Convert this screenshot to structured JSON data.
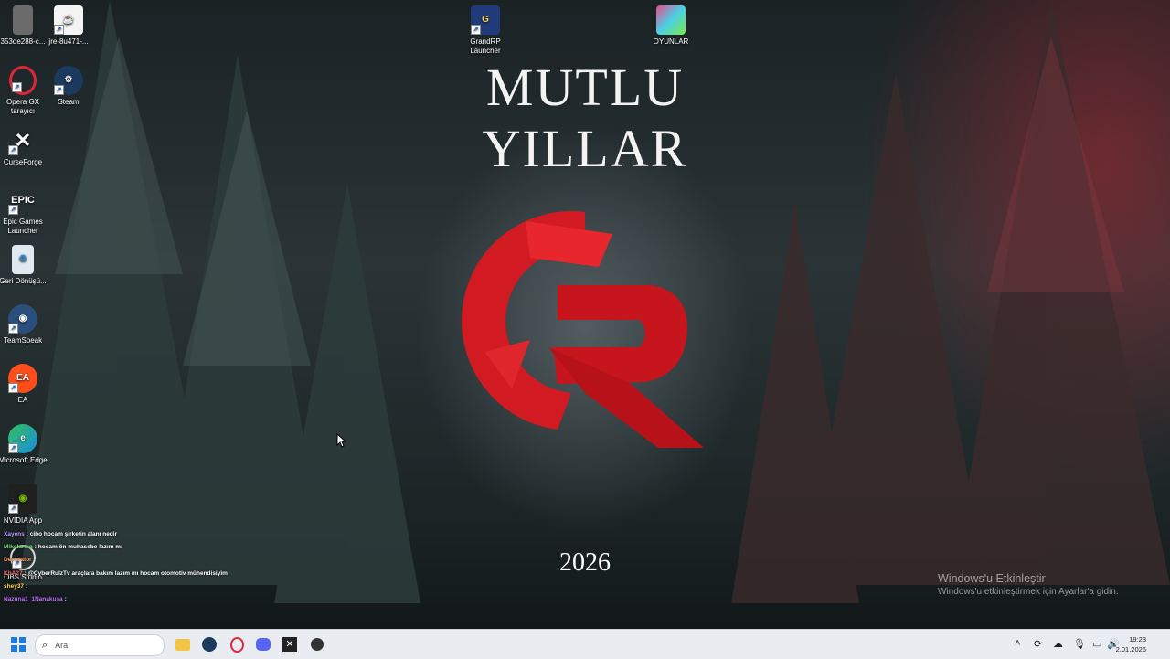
{
  "wallpaper": {
    "title": "MUTLU YILLAR",
    "year": "2026"
  },
  "desktop_icons": [
    {
      "label": "353de288-c...",
      "icon": "file-thumbnail-icon"
    },
    {
      "label": "jre-8u471-...",
      "icon": "java-icon"
    },
    {
      "label": "Opera GX tarayıcı",
      "icon": "opera-gx-icon"
    },
    {
      "label": "Steam",
      "icon": "steam-icon"
    },
    {
      "label": "CurseForge",
      "icon": "curseforge-icon"
    },
    {
      "label": "Epic Games Launcher",
      "icon": "epic-games-icon"
    },
    {
      "label": "Geri Dönüşü...",
      "icon": "recycle-bin-icon"
    },
    {
      "label": "TeamSpeak",
      "icon": "teamspeak-icon"
    },
    {
      "label": "EA",
      "icon": "ea-icon"
    },
    {
      "label": "Microsoft Edge",
      "icon": "edge-icon"
    },
    {
      "label": "NVIDIA App",
      "icon": "nvidia-icon"
    },
    {
      "label": "OBS Studio",
      "icon": "obs-icon"
    },
    {
      "label": "GrandRP Launcher",
      "icon": "grandrp-icon"
    },
    {
      "label": "OYUNLAR",
      "icon": "folder-games-icon"
    }
  ],
  "activation": {
    "heading": "Windows'u Etkinleştir",
    "subtext": "Windows'u etkinleştirmek için Ayarlar'a gidin."
  },
  "chat": [
    {
      "user": "Xayens",
      "text": ": cibo hocam şirketin alanı nedir",
      "color": "#b99cff"
    },
    {
      "user": "Mikelarsın",
      "text": ": hocam ön muhasebe lazım mı",
      "color": "#7fe07f"
    },
    {
      "user": "Devorator",
      "text": ":",
      "color": "#ff9d5c"
    },
    {
      "user": "KbA27",
      "text": ": @CyberRulzTv araçlara bakım lazım mı hocam otomotiv mühendisiyim",
      "color": "#ff6b6b"
    },
    {
      "user": "shey37",
      "text": ":",
      "color": "#ffd84d"
    },
    {
      "user": "Nazuna1_1Nanakusa",
      "text": ":",
      "color": "#c26bff"
    }
  ],
  "taskbar": {
    "search_placeholder": "Ara",
    "apps": [
      "file-explorer-icon",
      "steam-icon",
      "opera-gx-icon",
      "discord-icon",
      "curseforge-icon",
      "obs-icon"
    ],
    "time": "19:23",
    "date": "2.01.2026"
  },
  "colors": {
    "accent_red": "#d21a22",
    "taskbar_bg": "#e9edf2"
  }
}
